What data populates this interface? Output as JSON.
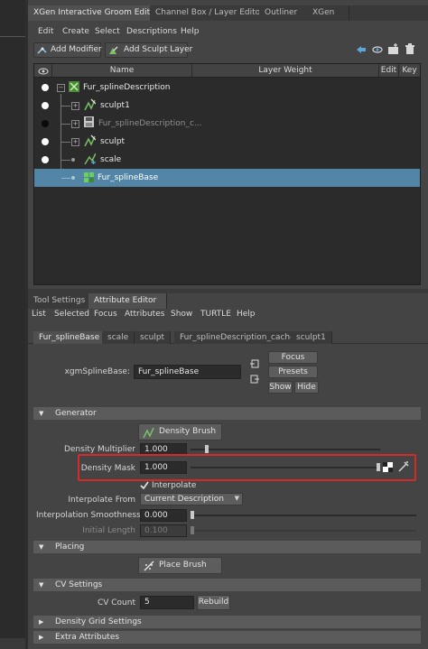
{
  "window_tabs": [
    "XGen Interactive Groom Editor",
    "Channel Box / Layer Editor",
    "Outliner",
    "XGen"
  ],
  "main_menu": [
    "Edit",
    "Create",
    "Select",
    "Descriptions",
    "Help"
  ],
  "toolbar": {
    "add_modifier": "Add Modifier",
    "add_sculpt_layer": "Add Sculpt Layer"
  },
  "outliner": {
    "columns": {
      "name": "Name",
      "layer_weight": "Layer Weight",
      "edit": "Edit",
      "key": "Key"
    },
    "rows": [
      {
        "label": "Fur_splineDescription",
        "icon": "xgen-description-icon",
        "visibility": "on"
      },
      {
        "label": "sculpt1",
        "icon": "sculpt-layer-icon",
        "visibility": "on"
      },
      {
        "label": "Fur_splineDescription_c...",
        "icon": "cache-icon",
        "visibility": "off"
      },
      {
        "label": "sculpt",
        "icon": "sculpt-layer-icon",
        "visibility": "on"
      },
      {
        "label": "scale",
        "icon": "scale-modifier-icon",
        "visibility": "on"
      },
      {
        "label": "Fur_splineBase",
        "icon": "spline-base-icon",
        "visibility": "",
        "selected": true
      }
    ]
  },
  "lower_tabs": [
    "Tool Settings",
    "Attribute Editor"
  ],
  "attr_menu": [
    "List",
    "Selected",
    "Focus",
    "Attributes",
    "Show",
    "TURTLE",
    "Help"
  ],
  "node_tabs": [
    "Fur_splineBase",
    "scale",
    "sculpt",
    "Fur_splineDescription_cache",
    "sculpt1"
  ],
  "node": {
    "label": "xgmSplineBase:",
    "value": "Fur_splineBase",
    "focus": "Focus",
    "presets": "Presets",
    "show": "Show",
    "hide": "Hide"
  },
  "sections": {
    "generator": "Generator",
    "placing": "Placing",
    "cv_settings": "CV Settings",
    "density_grid": "Density Grid Settings",
    "extra": "Extra Attributes"
  },
  "generator": {
    "density_brush": "Density Brush",
    "density_multiplier_label": "Density Multiplier",
    "density_multiplier": "1.000",
    "density_multiplier_level": 0.08,
    "density_mask_label": "Density Mask",
    "density_mask": "1.000",
    "density_mask_level": 1.0,
    "interpolate_label": "Interpolate",
    "interpolate_from_label": "Interpolate From",
    "interpolate_from": "Current Description",
    "interp_smooth_label": "Interpolation Smoothness",
    "interp_smooth": "0.000",
    "interp_smooth_level": 0.0,
    "initial_length_label": "Initial Length",
    "initial_length": "0.100",
    "initial_length_level": 0.0
  },
  "placing": {
    "place_brush": "Place Brush"
  },
  "cv": {
    "count_label": "CV Count",
    "count": "5",
    "rebuild": "Rebuild"
  },
  "colors": {
    "highlight": "#d42a2a",
    "selection": "#5285a6",
    "panel": "#444444"
  }
}
